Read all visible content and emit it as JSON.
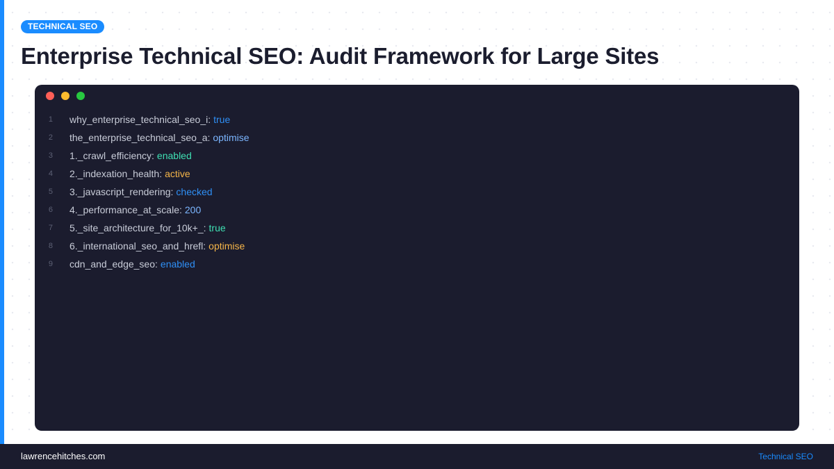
{
  "header": {
    "badge": "TECHNICAL SEO",
    "title": "Enterprise Technical SEO: Audit Framework for Large Sites"
  },
  "colors": {
    "accent": "#1a8cff",
    "dark_bg": "#1b1c2e",
    "value_blue": "#2f8ff5",
    "value_light_blue": "#7cb6ff",
    "value_green": "#3fe0b3",
    "value_orange": "#f5b549"
  },
  "code": {
    "lines": [
      {
        "num": "1",
        "key": "why_enterprise_technical_seo_i",
        "value": "true",
        "color": "#2f8ff5"
      },
      {
        "num": "2",
        "key": "the_enterprise_technical_seo_a",
        "value": "optimise",
        "color": "#7cb6ff"
      },
      {
        "num": "3",
        "key": "1._crawl_efficiency",
        "value": "enabled",
        "color": "#3fe0b3"
      },
      {
        "num": "4",
        "key": "2._indexation_health",
        "value": "active",
        "color": "#f5b549"
      },
      {
        "num": "5",
        "key": "3._javascript_rendering",
        "value": "checked",
        "color": "#2f8ff5"
      },
      {
        "num": "6",
        "key": "4._performance_at_scale",
        "value": "200",
        "color": "#7cb6ff"
      },
      {
        "num": "7",
        "key": "5._site_architecture_for_10k+_",
        "value": "true",
        "color": "#3fe0b3"
      },
      {
        "num": "8",
        "key": "6._international_seo_and_hrefl",
        "value": "optimise",
        "color": "#f5b549"
      },
      {
        "num": "9",
        "key": "cdn_and_edge_seo",
        "value": "enabled",
        "color": "#2f8ff5"
      }
    ]
  },
  "footer": {
    "site": "lawrencehitches.com",
    "category": "Technical SEO"
  }
}
